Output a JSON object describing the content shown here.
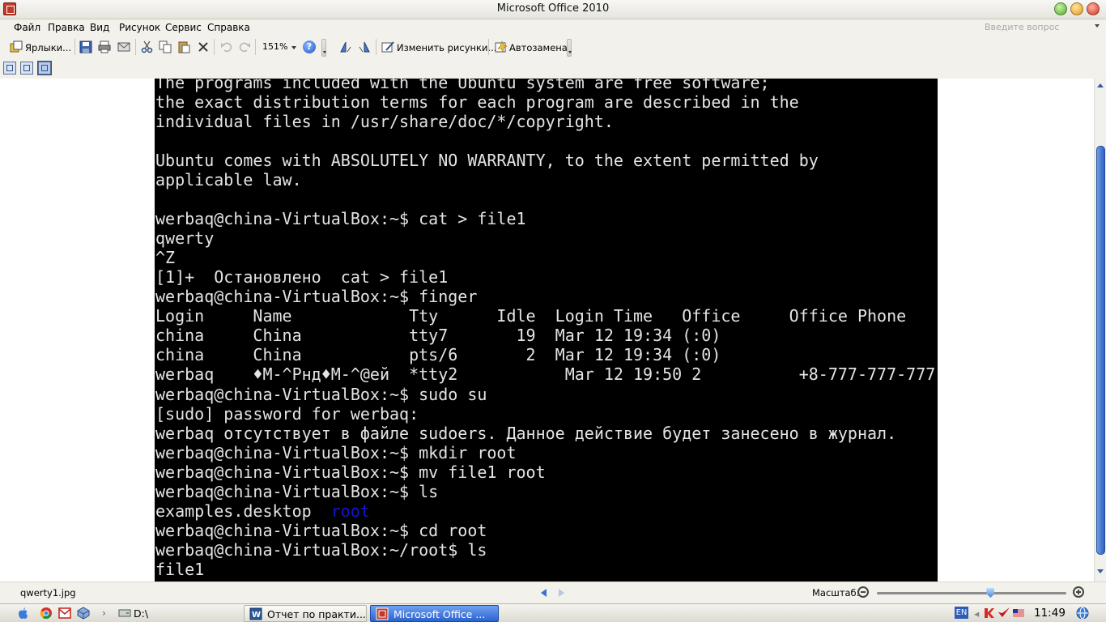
{
  "window": {
    "title": "Microsoft Office 2010"
  },
  "menu": {
    "items": [
      "Файл",
      "Правка",
      "Вид",
      "Рисунок",
      "Сервис",
      "Справка"
    ],
    "help_placeholder": "Введите вопрос"
  },
  "toolbar": {
    "shortcuts_label": "Ярлыки...",
    "zoom_value": "151%",
    "edit_pictures_label": "Изменить рисунки...",
    "autocorrect_label": "Автозамена"
  },
  "terminal": {
    "lines": [
      "The programs included with the Ubuntu system are free software;",
      "the exact distribution terms for each program are described in the",
      "individual files in /usr/share/doc/*/copyright.",
      "",
      "Ubuntu comes with ABSOLUTELY NO WARRANTY, to the extent permitted by",
      "applicable law.",
      "",
      "werbaq@china-VirtualBox:~$ cat > file1",
      "qwerty",
      "^Z",
      "[1]+  Остановлено  cat > file1",
      "werbaq@china-VirtualBox:~$ finger",
      "Login     Name            Tty      Idle  Login Time   Office     Office Phone",
      "china     China           tty7       19  Mar 12 19:34 (:0)",
      "china     China           pts/6       2  Mar 12 19:34 (:0)",
      "werbaq    ♦M-^Рнд♦M-^@ей  *tty2           Mar 12 19:50 2          +8-777-777-777",
      "werbaq@china-VirtualBox:~$ sudo su",
      "[sudo] password for werbaq:",
      "werbaq отсутствует в файле sudoers. Данное действие будет занесено в журнал.",
      "werbaq@china-VirtualBox:~$ mkdir root",
      "werbaq@china-VirtualBox:~$ mv file1 root",
      "werbaq@china-VirtualBox:~$ ls",
      "",
      "werbaq@china-VirtualBox:~$ cd root",
      "werbaq@china-VirtualBox:~/root$ ls",
      "file1"
    ],
    "ls_output_file": "examples.desktop",
    "ls_output_dir": "root",
    "text_color": "#e4e4e4",
    "dir_color": "#1414d2"
  },
  "status": {
    "filename": "qwerty1.jpg",
    "zoom_label": "Масштаб:",
    "zoom_level": 0.6
  },
  "taskbar": {
    "drive_label": "D:\\",
    "tasks": [
      "Отчет по практи...",
      "Microsoft Office ..."
    ],
    "language": "EN",
    "clock": "11:49"
  }
}
